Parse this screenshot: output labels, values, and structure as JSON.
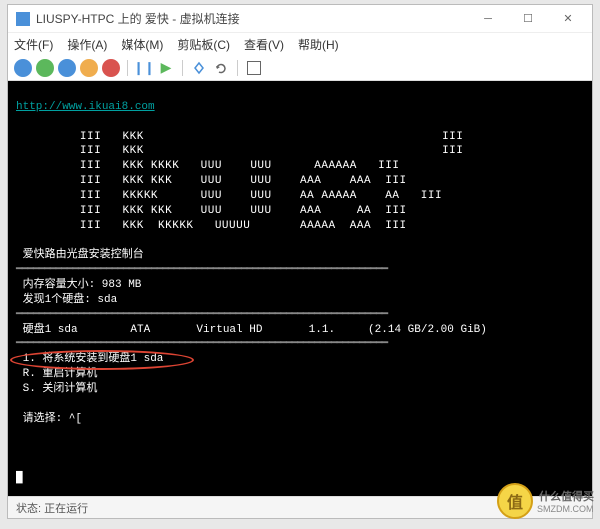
{
  "titlebar": {
    "title": "LIUSPY-HTPC 上的 爱快 - 虚拟机连接"
  },
  "menubar": {
    "file": "文件(F)",
    "action": "操作(A)",
    "media": "媒体(M)",
    "clipboard": "剪贴板(C)",
    "view": "查看(V)",
    "help": "帮助(H)"
  },
  "terminal": {
    "url": "http://www.ikuai8.com",
    "ascii1": "         III   KKK                                          III",
    "ascii2": "         III   KKK                                          III",
    "ascii3": "         III   KKK KKKK   UUU    UUU      AAAAAA   III",
    "ascii4": "         III   KKK KKK    UUU    UUU    AAA    AAA  III",
    "ascii5": "         III   KKKKK      UUU    UUU    AA AAAAA    AA   III",
    "ascii6": "         III   KKK KKK    UUU    UUU    AAA     AA  III",
    "ascii7": "         III   KKK  KKKKK   UUUUU       AAAAA  AAA  III",
    "console_title": " 爱快路由光盘安装控制台",
    "sep": "━━━━━━━━━━━━━━━━━━━━━━━━━━━━━━━━━━━━━━━━━━━━━━━━━━━━━━━━━━━━━━━━━━",
    "mem": " 内存容量大小: 983 MB",
    "disk_found": " 发现1个硬盘: sda",
    "disk_info": " 硬盘1 sda        ATA       Virtual HD       1.1.     (2.14 GB/2.00 GiB)",
    "opt1": " 1. 将系统安装到硬盘1 sda",
    "opt2": " R. 重启计算机",
    "opt3": " S. 关闭计算机",
    "prompt": " 请选择: ^[",
    "cursor": "█"
  },
  "statusbar": {
    "label": "状态:",
    "value": "正在运行"
  },
  "watermark": {
    "badge": "值",
    "text": "什么值得买",
    "sub": "SMZDM.COM"
  }
}
